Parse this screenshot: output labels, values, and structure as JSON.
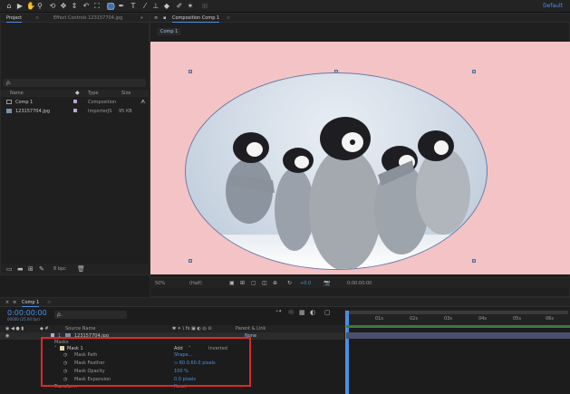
{
  "toolbar": {
    "workspace": "Default"
  },
  "project_panel": {
    "tab_project": "Project",
    "tab_effect_controls": "Effect Controls 123157704.jpg",
    "search_placeholder": "ρ.",
    "columns": {
      "name": "Name",
      "type": "Type",
      "size": "Size"
    },
    "items": [
      {
        "name": "Comp 1",
        "type": "Composition",
        "size": ""
      },
      {
        "name": "123157704.jpg",
        "type": "ImporterJS",
        "size": "95 KB"
      }
    ],
    "bpc": "8 bpc"
  },
  "composition_panel": {
    "tab_label": "Composition Comp 1",
    "sub_tab": "Comp 1",
    "zoom": "50%",
    "quality": "(Half)",
    "exposure": "+0.0",
    "timecode": "0:00:00:00"
  },
  "timeline": {
    "comp_tab": "Comp 1",
    "timecode": "0:00:00:00",
    "fps": "00000 (25.00 fps)",
    "search_placeholder": "ρ.",
    "col_source_name": "Source Name",
    "col_parent": "Parent & Link",
    "layer": {
      "number": "1",
      "name": "123157704.jpg",
      "parent": "None"
    },
    "masks_label": "Masks",
    "mask1": {
      "name": "Mask 1",
      "mode": "Add",
      "inverted": "Inverted"
    },
    "mask_props": [
      {
        "name": "Mask Path",
        "value": "Shape..."
      },
      {
        "name": "Mask Feather",
        "value": "∞ 60.0,60.0 pixels"
      },
      {
        "name": "Mask Opacity",
        "value": "100 %"
      },
      {
        "name": "Mask Expansion",
        "value": "0.0 pixels"
      }
    ],
    "transform_label": "Transform",
    "transform_value": "Reset",
    "ruler": [
      "01s",
      "02s",
      "03s",
      "04s",
      "05s",
      "06s"
    ]
  },
  "colors": {
    "accent": "#4a90e2",
    "mask_highlight": "#d82a2a",
    "comp_bg": "#f4c3c5"
  }
}
